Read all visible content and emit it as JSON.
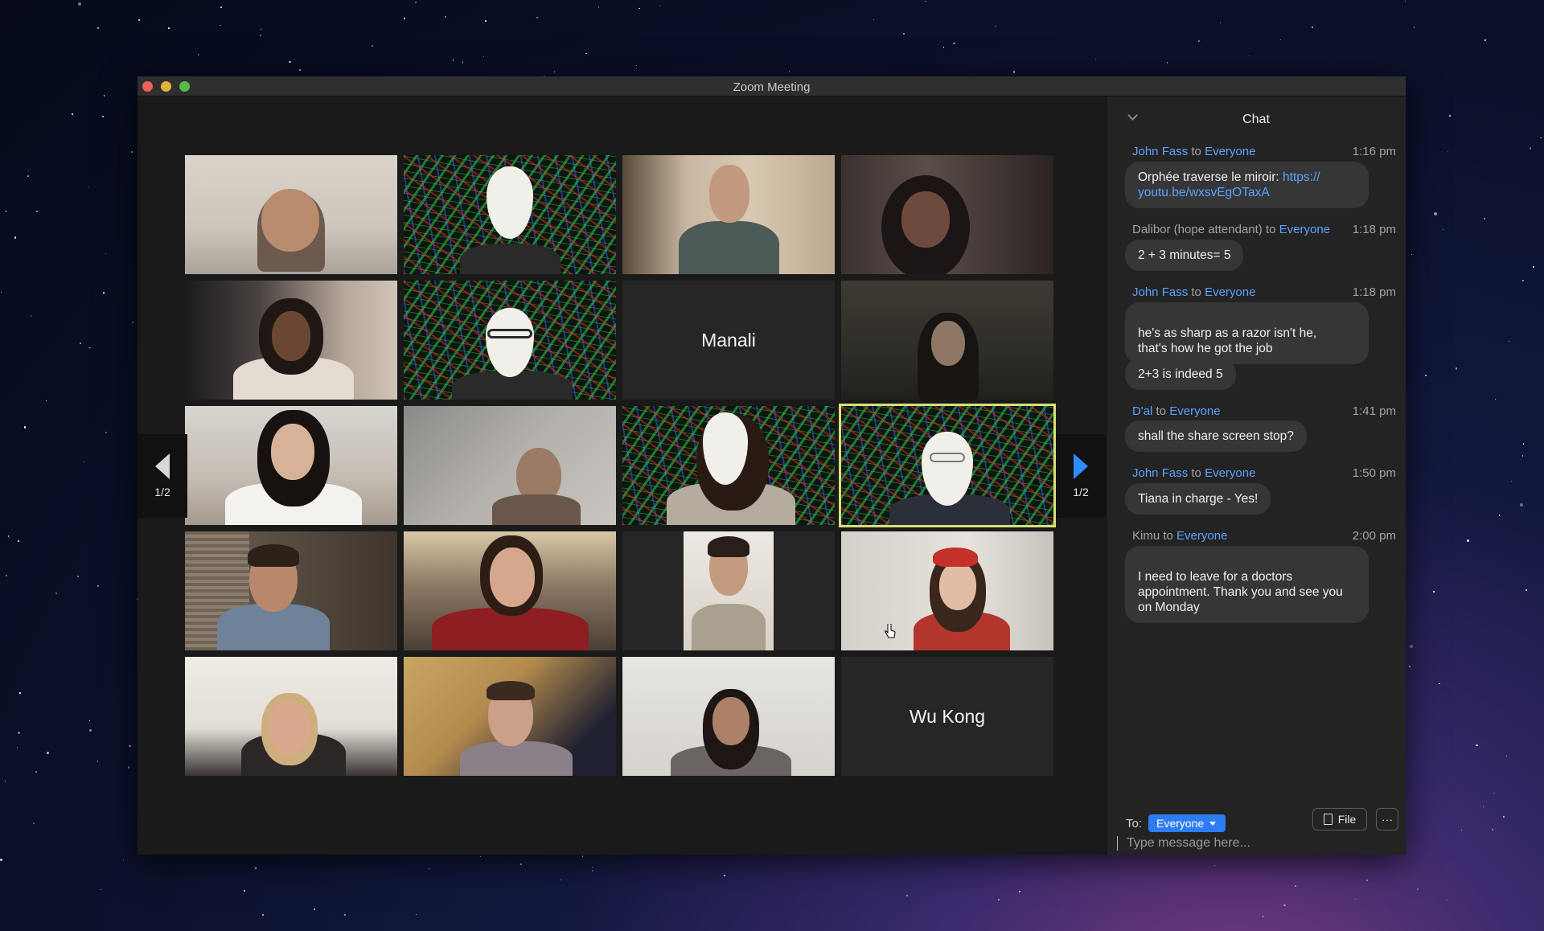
{
  "window": {
    "title": "Zoom Meeting"
  },
  "gallery": {
    "page_indicator_left": "1/2",
    "page_indicator_right": "1/2",
    "name_tiles": [
      "Manali",
      "Wu Kong"
    ]
  },
  "chat": {
    "title": "Chat",
    "messages": [
      {
        "sender": "John Fass",
        "to_word": "to",
        "recipient": "Everyone",
        "time": "1:16 pm",
        "text": "Orphée traverse le miroir: ",
        "link": "https://\nyoutu.be/wxsvEgOTaxA"
      },
      {
        "sender": "Dalibor (hope attendant)",
        "to_word": "to",
        "recipient": "Everyone",
        "time": "1:18 pm",
        "text": "2 + 3 minutes= 5"
      },
      {
        "sender": "John Fass",
        "to_word": "to",
        "recipient": "Everyone",
        "time": "1:18 pm",
        "text": "he's as sharp as a razor isn't he,\nthat's how he got the job",
        "text2": "2+3 is indeed 5"
      },
      {
        "sender": "D'al",
        "to_word": "to",
        "recipient": "Everyone",
        "time": "1:41 pm",
        "text": "shall the share screen stop?"
      },
      {
        "sender": "John Fass",
        "to_word": "to",
        "recipient": "Everyone",
        "time": "1:50 pm",
        "text": "Tiana in charge - Yes!"
      },
      {
        "sender": "Kimu",
        "to_word": "to",
        "recipient": "Everyone",
        "time": "2:00 pm",
        "text": "I need to leave for a doctors\nappointment. Thank you and see you\non Monday"
      }
    ],
    "to_label": "To:",
    "to_value": "Everyone",
    "file_label": "File",
    "more_label": "···",
    "input_placeholder": "Type message here..."
  },
  "icons": {
    "collapse": "chevron-down-icon",
    "prev": "arrow-left-icon",
    "next": "arrow-right-icon",
    "file": "file-icon",
    "more": "more-icon"
  },
  "colors": {
    "accent": "#2d8cff",
    "active_speaker_border": "#d8de7a",
    "chat_bg": "#232323",
    "bubble_bg": "#363636"
  }
}
